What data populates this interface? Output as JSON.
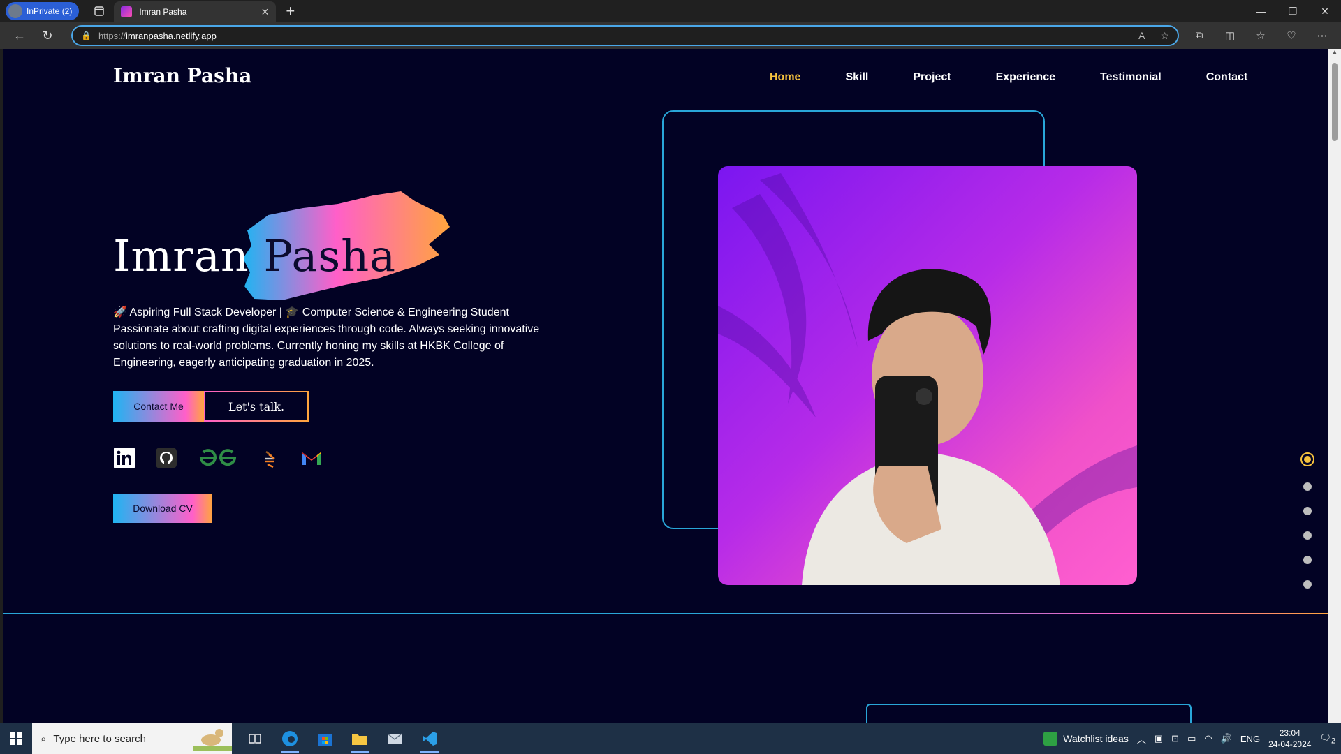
{
  "browser": {
    "profile_label": "InPrivate (2)",
    "tab_title": "Imran Pasha",
    "url_protocol": "https://",
    "url_host": "imranpasha.netlify.app"
  },
  "site": {
    "logo": "Imran Pasha",
    "nav": [
      "Home",
      "Skill",
      "Project",
      "Experience",
      "Testimonial",
      "Contact"
    ],
    "active_nav": "Home",
    "hero_first": "Imran ",
    "hero_last": "Pasha",
    "bio_line1": "🚀 Aspiring Full Stack Developer | 🎓 Computer Science & Engineering Student",
    "bio_line2": "Passionate about crafting digital experiences through code. Always seeking innovative solutions to real-world problems. Currently honing my skills at HKBK College of Engineering, eagerly anticipating graduation in 2025.",
    "contact_btn": "Contact Me",
    "talk_btn": "Let's talk.",
    "cv_btn": "Download CV",
    "socials": [
      "linkedin-icon",
      "github-icon",
      "geeksforgeeks-icon",
      "stackoverflow-icon",
      "gmail-icon"
    ],
    "section_dots_count": 6,
    "active_dot": 0
  },
  "colors": {
    "page_bg": "#020224",
    "accent_yellow": "#f6c23e",
    "outline_blue": "#29a6d8",
    "gradient_pink": "#ff5fc9",
    "gradient_orange": "#ffa53d"
  },
  "taskbar": {
    "search_placeholder": "Type here to search",
    "watchlist": "Watchlist ideas",
    "lang": "ENG",
    "time": "23:04",
    "date": "24-04-2024",
    "notif_count": "2"
  }
}
